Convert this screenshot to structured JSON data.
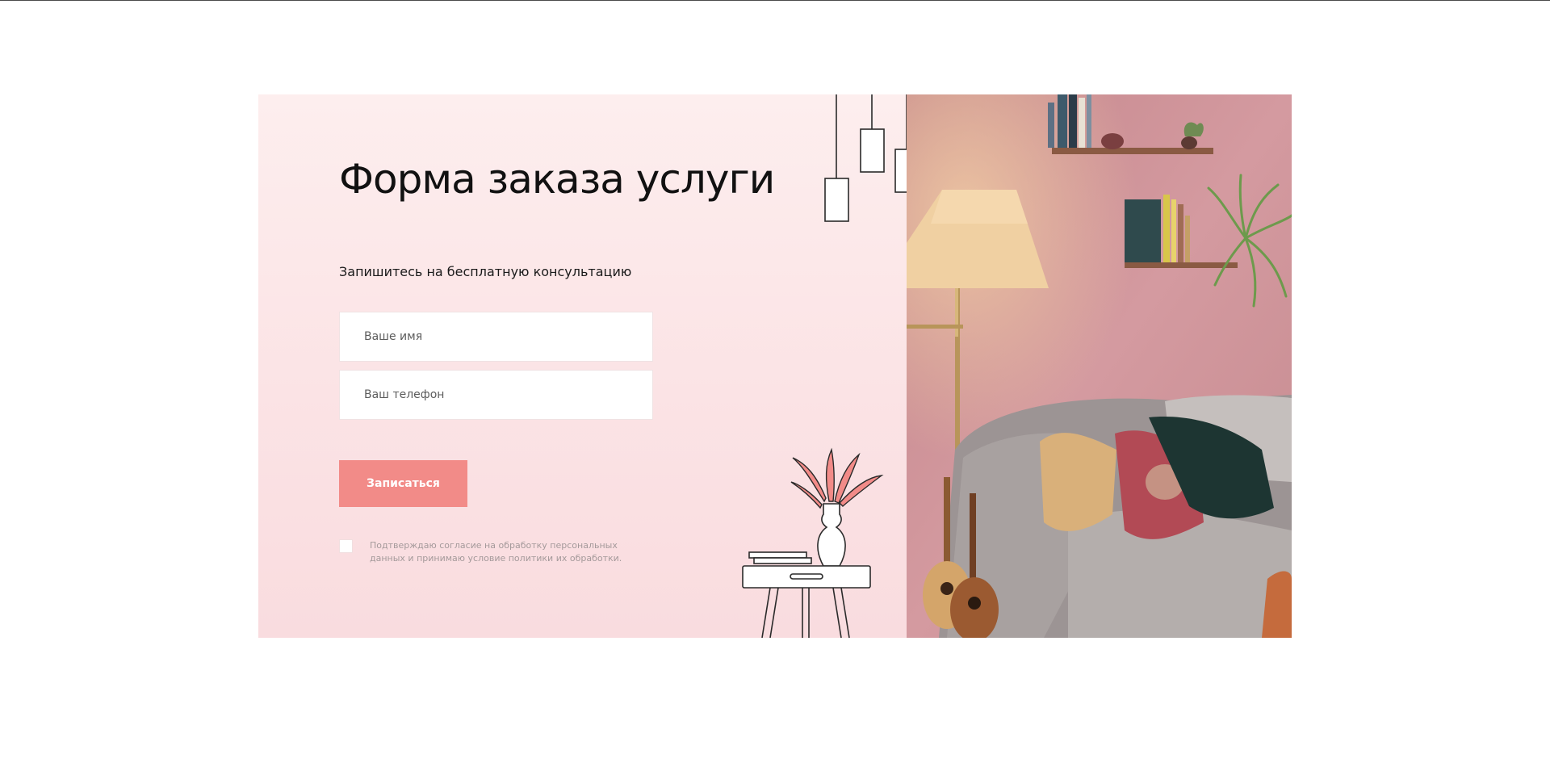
{
  "form": {
    "title": "Форма заказа услуги",
    "subtitle": "Запишитесь на бесплатную консультацию",
    "name_placeholder": "Ваше имя",
    "phone_placeholder": "Ваш телефон",
    "submit_label": "Записаться",
    "consent_text": "Подтверждаю согласие на обработку персональных данных и принимаю условие политики их обработки.",
    "consent_checked": false
  },
  "colors": {
    "accent": "#f28b88",
    "panel_background": "#fbe6e7",
    "wall": "#c98f94"
  },
  "icons": {
    "pendant_lamps": "pendant-lamps-icon",
    "side_table": "side-table-icon",
    "vase_plant": "vase-plant-icon",
    "checkbox": "checkbox-icon"
  }
}
